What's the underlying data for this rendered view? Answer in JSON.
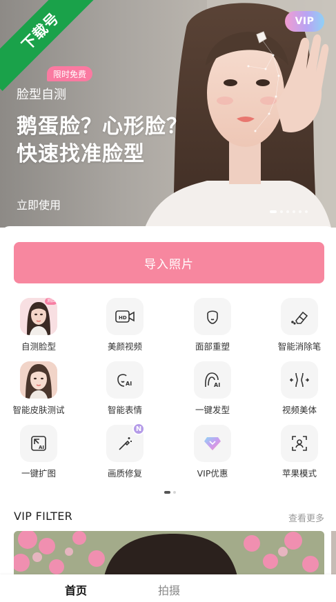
{
  "watermark": {
    "text": "下载号"
  },
  "hero": {
    "vip_badge": "VIP",
    "promo_tag": "限时免费",
    "subtitle": "脸型自测",
    "title_lines": [
      "鹅蛋脸？心形脸？",
      "快速找准脸型"
    ],
    "cta": "立即使用",
    "slides_total": 6,
    "active_slide": 1
  },
  "import_button": {
    "label": "导入照片"
  },
  "tools": [
    {
      "label": "自测脸型",
      "icon": "face-test-avatar",
      "badge": ""
    },
    {
      "label": "美颜视频",
      "icon": "hd-video-icon",
      "badge": ""
    },
    {
      "label": "面部重塑",
      "icon": "face-outline-icon",
      "badge": ""
    },
    {
      "label": "智能消除笔",
      "icon": "eraser-icon",
      "badge": ""
    },
    {
      "label": "智能皮肤测试",
      "icon": "skin-test-avatar",
      "badge": ""
    },
    {
      "label": "智能表情",
      "icon": "ai-expression-icon",
      "badge": ""
    },
    {
      "label": "一键发型",
      "icon": "ai-hairstyle-icon",
      "badge": ""
    },
    {
      "label": "视频美体",
      "icon": "body-shape-icon",
      "badge": ""
    },
    {
      "label": "一键扩图",
      "icon": "ai-expand-icon",
      "badge": ""
    },
    {
      "label": "画质修复",
      "icon": "magic-wand-icon",
      "badge": "N"
    },
    {
      "label": "VIP优惠",
      "icon": "vip-diamond-icon",
      "badge": ""
    },
    {
      "label": "苹果模式",
      "icon": "face-scan-icon",
      "badge": ""
    }
  ],
  "tools_pages": {
    "total": 2,
    "active": 1
  },
  "vip_filter": {
    "title": "VIP FILTER",
    "see_more": "查看更多"
  },
  "tabbar": {
    "items": [
      "首页",
      "拍摄"
    ],
    "active": "首页"
  },
  "colors": {
    "primary_pink": "#f7879f",
    "tag_pink": "#fa7aa1",
    "watermark_green": "#1aa24a",
    "badge_purple": "#b49be8"
  }
}
